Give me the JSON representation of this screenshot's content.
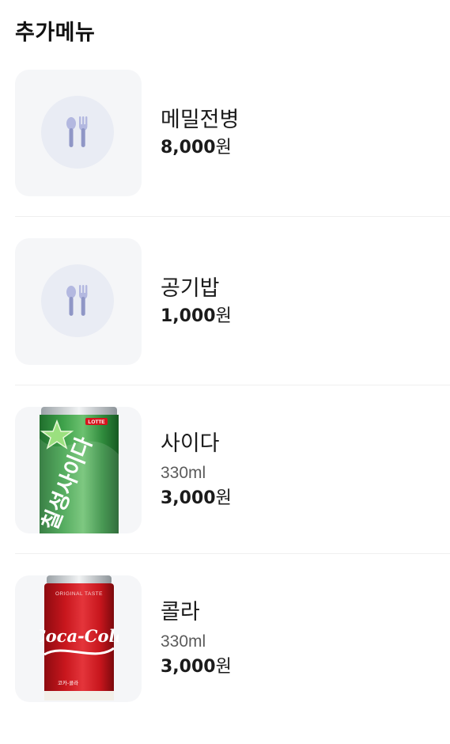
{
  "section": {
    "title": "추가메뉴"
  },
  "items": [
    {
      "name": "메밀전병",
      "description": "",
      "price": "8,000",
      "currency": "원",
      "image": "utensils-placeholder-icon"
    },
    {
      "name": "공기밥",
      "description": "",
      "price": "1,000",
      "currency": "원",
      "image": "utensils-placeholder-icon"
    },
    {
      "name": "사이다",
      "description": "330ml",
      "price": "3,000",
      "currency": "원",
      "image": "cider-can-image",
      "can_brand_text": "LOTTE",
      "can_label_text": "칠성사이다"
    },
    {
      "name": "콜라",
      "description": "330ml",
      "price": "3,000",
      "currency": "원",
      "image": "cola-can-image",
      "can_top_text": "ORIGINAL TASTE",
      "can_logo_text": "Coca-Cola",
      "can_bottom_text": "코카-콜라"
    }
  ],
  "colors": {
    "thumb_bg": "#f5f6f8",
    "placeholder_circle": "#e9ecf4",
    "utensil": "#8f96c6",
    "cider_green": "#2f8a3c",
    "cola_red": "#c8161d"
  }
}
